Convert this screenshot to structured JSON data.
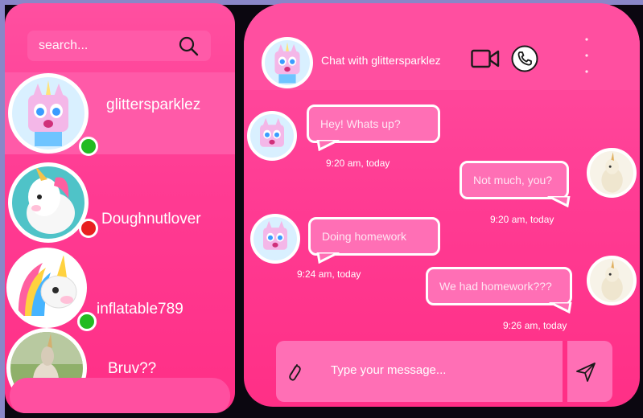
{
  "search": {
    "placeholder": "search..."
  },
  "contacts": [
    {
      "name": "glittersparklez",
      "status": "online",
      "status_color": "#22bb22"
    },
    {
      "name": "Doughnutlover",
      "status": "busy",
      "status_color": "#e82020"
    },
    {
      "name": "inflatable789",
      "status": "online",
      "status_color": "#22bb22"
    },
    {
      "name": "Bruv??",
      "status": "",
      "status_color": ""
    }
  ],
  "chat": {
    "title": "Chat with glittersparklez",
    "messages": [
      {
        "from": "them",
        "text": "Hey! Whats up?",
        "time": "9:20 am, today"
      },
      {
        "from": "me",
        "text": "Not much, you?",
        "time": "9:20 am, today"
      },
      {
        "from": "them",
        "text": "Doing homework",
        "time": "9:24 am, today"
      },
      {
        "from": "me",
        "text": "We had homework???",
        "time": "9:26 am, today"
      }
    ],
    "composer_placeholder": "Type your message..."
  },
  "colors": {
    "accent": "#ff3b93",
    "bubble": "#ff6fb5",
    "online": "#22bb22",
    "busy": "#e82020"
  },
  "icons": {
    "search": "search-icon",
    "video": "video-camera-icon",
    "phone": "phone-icon",
    "menu": "more-vertical-icon",
    "attach": "paperclip-icon",
    "send": "send-icon"
  }
}
